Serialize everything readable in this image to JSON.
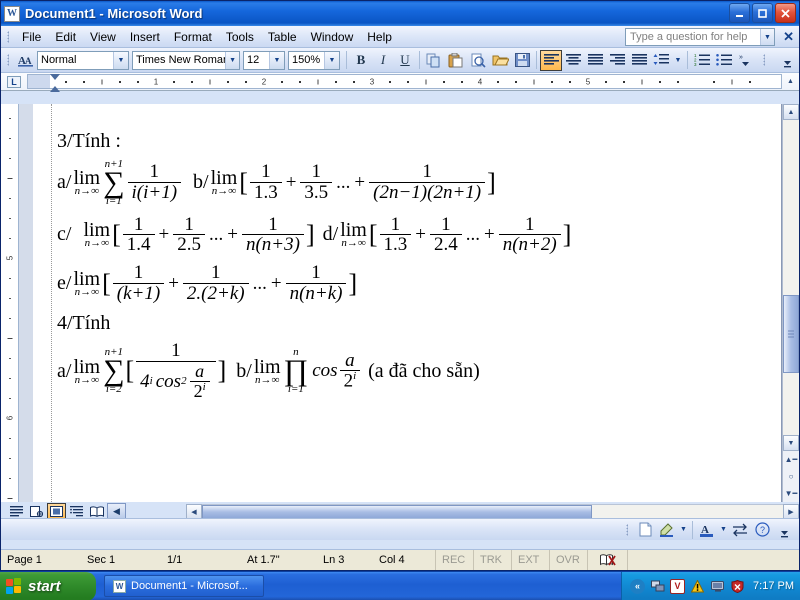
{
  "window": {
    "title": "Document1 - Microsoft Word",
    "icon": "word-document-icon",
    "minimize_label": "_",
    "maximize_label": "□",
    "close_label": "✕"
  },
  "menu": {
    "items": [
      "File",
      "Edit",
      "View",
      "Insert",
      "Format",
      "Tools",
      "Table",
      "Window",
      "Help"
    ],
    "help_placeholder": "Type a question for help",
    "close_label": "✕"
  },
  "toolbar": {
    "style_value": "Normal",
    "font_value": "Times New Roman",
    "size_value": "12",
    "zoom_value": "150%",
    "bold_label": "B",
    "italic_label": "I",
    "underline_label": "U",
    "buttons": [
      {
        "name": "copy-button",
        "label": "copy-icon"
      },
      {
        "name": "paste-button",
        "label": "paste-icon"
      },
      {
        "name": "print-preview-button",
        "label": "print-preview-icon"
      },
      {
        "name": "open-button",
        "label": "folder-open-icon"
      },
      {
        "name": "save-button",
        "label": "floppy-save-icon"
      },
      {
        "name": "align-left-button",
        "label": "align-left-icon"
      },
      {
        "name": "align-center-button",
        "label": "align-center-icon"
      },
      {
        "name": "align-justify-button",
        "label": "align-justify-icon"
      },
      {
        "name": "align-right-button",
        "label": "align-right-icon"
      },
      {
        "name": "distribute-button",
        "label": "distribute-icon"
      },
      {
        "name": "line-spacing-button",
        "label": "line-spacing-icon"
      },
      {
        "name": "numbered-list-button",
        "label": "numbered-list-icon"
      },
      {
        "name": "bulleted-list-button",
        "label": "bulleted-list-icon"
      }
    ],
    "overflow_label": "»"
  },
  "ruler": {
    "corner_label": "L",
    "horizontal_ticks": [
      "1",
      "2",
      "3",
      "4",
      "5"
    ],
    "vertical_ticks": [
      "5",
      "6"
    ]
  },
  "document": {
    "lines": [
      {
        "id": "line-3-tinh",
        "text": "3/Tính :"
      },
      {
        "id": "line-3a-3b",
        "text": "a/ lim n→∞ ∑(i=1..n+1) 1/(i(i+1))   b/ lim n→∞ [ 1/1.3 + 1/3.5 + ... + 1/((2n−1)(2n+1)) ]"
      },
      {
        "id": "line-3c-3d",
        "text": "c/ lim n→∞ [ 1/1.4 + 1/2.5 + ... + 1/(n(n+3)) ]   d/ lim n→∞ [ 1/1.3 + 1/2.4 + ... + 1/(n(n+2)) ]"
      },
      {
        "id": "line-3e",
        "text": "e/ lim n→∞ [ 1/(k+1) + 1/(2.(2+k)) + ... + 1/(n(n+k)) ]"
      },
      {
        "id": "line-4-tinh",
        "text": "4/Tính"
      },
      {
        "id": "line-4a-4b",
        "text": "a/ lim n→∞ ∑(i=2..n+1) [ 1/(4^i cos² (a/2^i)) ]   b/ lim n→∞ ∏(i=1..n) cos (a/2^i)  (a đã cho sẵn)"
      }
    ],
    "tokens": {
      "heading3": "3/Tính :",
      "heading4": "4/Tính",
      "label_a": "a/",
      "label_b": "b/",
      "label_c": "c/",
      "label_d": "d/",
      "label_e": "e/",
      "lim": "lim",
      "n_to_inf": "n→∞",
      "sigma": "∑",
      "prod": "∏",
      "i_eq_1": "i=1",
      "i_eq_2": "i=2",
      "n_plus_1": "n+1",
      "n": "n",
      "one": "1",
      "plus": "+",
      "ellipsis": "...",
      "lbrack": "[",
      "rbrack": "]",
      "d_ii1": "i(i+1)",
      "d_13": "1.3",
      "d_35": "3.5",
      "d_2n": "(2n−1)(2n+1)",
      "d_14": "1.4",
      "d_25": "2.5",
      "d_nn3": "n(n+3)",
      "d_24": "2.4",
      "d_nn2": "n(n+2)",
      "d_k1": "(k+1)",
      "d_22k": "2.(2+k)",
      "d_nnk": "n(n+k)",
      "four": "4",
      "cos": "cos",
      "cos_sq": "cos",
      "sup_i": "i",
      "sup_2": "2",
      "a": "a",
      "two": "2",
      "note": "(a đã cho sẵn)"
    }
  },
  "view_buttons": [
    {
      "name": "view-normal",
      "label": "normal-view-icon"
    },
    {
      "name": "view-web-layout",
      "label": "web-layout-icon"
    },
    {
      "name": "view-print-layout",
      "label": "print-layout-icon"
    },
    {
      "name": "view-outline",
      "label": "outline-view-icon"
    },
    {
      "name": "view-reading",
      "label": "reading-layout-icon"
    },
    {
      "name": "view-prev",
      "label": "chevron-left-icon"
    }
  ],
  "drawing_toolbar": [
    {
      "name": "new-shape-button",
      "label": "page-icon"
    },
    {
      "name": "highlight-color-button",
      "label": "highlighter-icon"
    },
    {
      "name": "font-color-button",
      "label": "font-color-icon"
    },
    {
      "name": "arrows-button",
      "label": "arrows-icon"
    },
    {
      "name": "help-button",
      "label": "question-mark-icon"
    }
  ],
  "statusbar": {
    "page": "Page  1",
    "sec": "Sec  1",
    "pages": "1/1",
    "at": "At  1.7\"",
    "ln": "Ln  3",
    "col": "Col  4",
    "rec": "REC",
    "trk": "TRK",
    "ext": "EXT",
    "ovr": "OVR",
    "lang_icon": "spelling-check-icon"
  },
  "taskbar": {
    "start_label": "start",
    "task_title": "Document1 - Microsof...",
    "clock": "7:17 PM",
    "tray_icons": [
      {
        "name": "show-hidden-icons",
        "label": "«"
      },
      {
        "name": "network-icon",
        "label": "net"
      },
      {
        "name": "v-app-icon",
        "label": "V"
      },
      {
        "name": "warning-icon",
        "label": "!"
      },
      {
        "name": "display-icon",
        "label": "disp"
      },
      {
        "name": "security-alert-icon",
        "label": "✖"
      }
    ]
  },
  "colors": {
    "title_blue": "#1567dc",
    "toolbar_blue": "#dbe5f7",
    "accent_orange": "#fdb94e",
    "taskbar_blue": "#2366d8",
    "start_green": "#2f8a2a",
    "status_bg": "#ece9d8"
  }
}
